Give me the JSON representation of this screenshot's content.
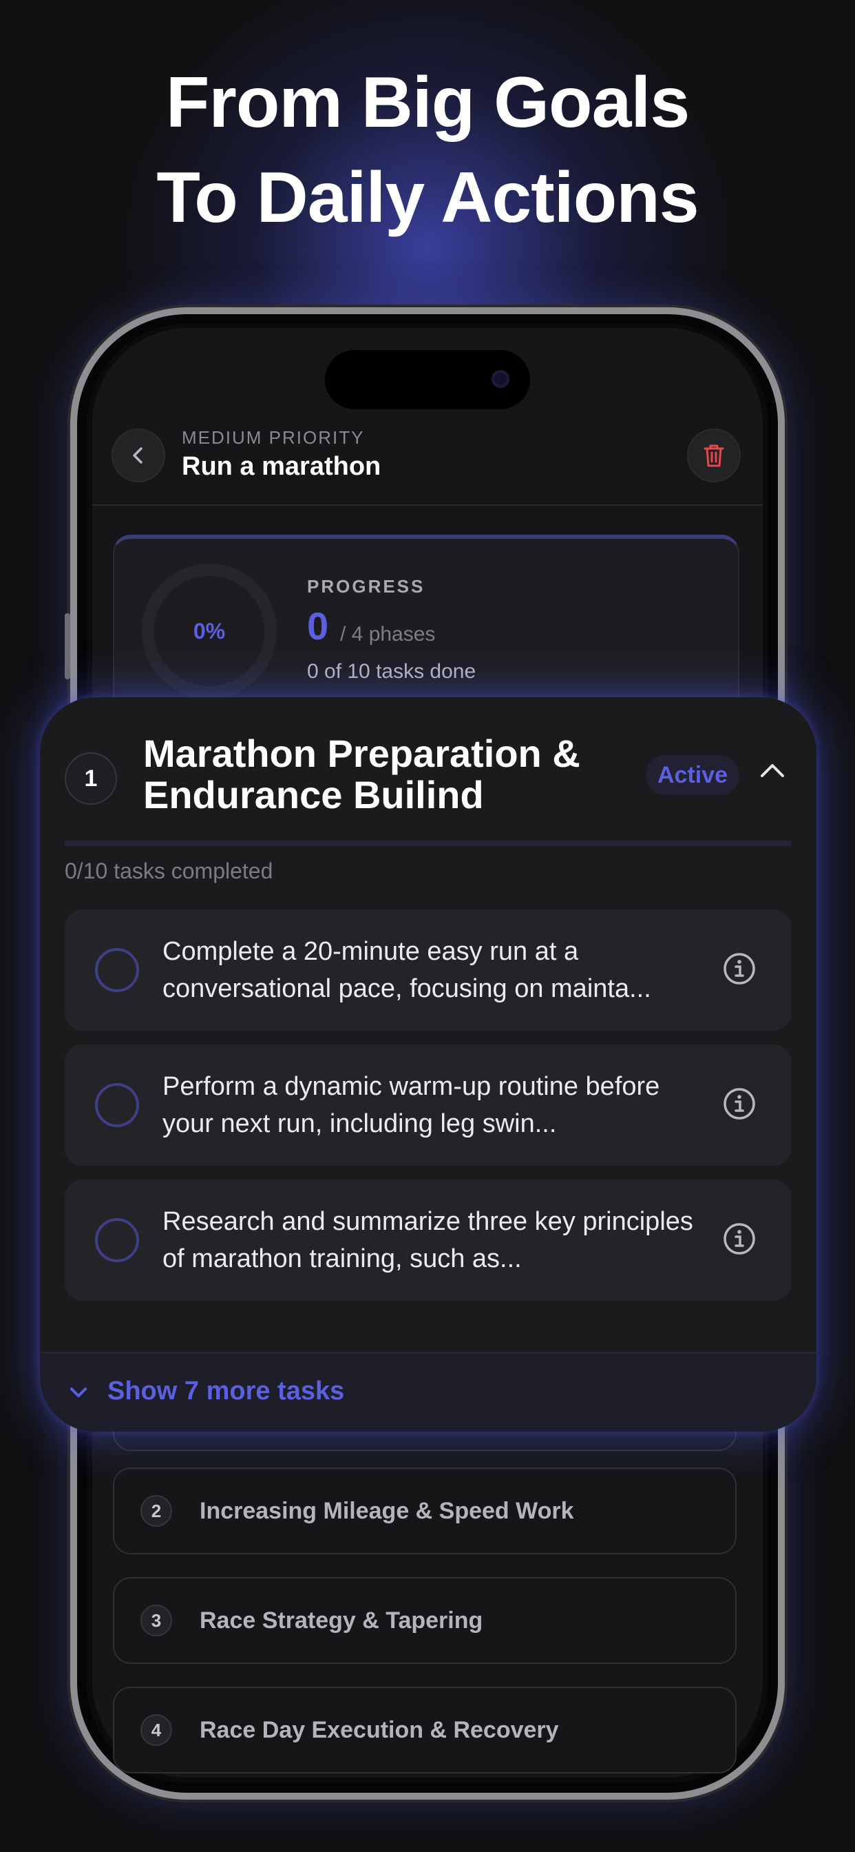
{
  "headline": {
    "line1": "From Big Goals",
    "line2": "To Daily Actions"
  },
  "goal": {
    "priority": "MEDIUM PRIORITY",
    "title": "Run a marathon"
  },
  "progress": {
    "percent_label": "0%",
    "label": "PROGRESS",
    "count": "0",
    "phases_text": "/ 4 phases",
    "tasks_text": "0 of 10 tasks done",
    "percent": 0
  },
  "active_phase": {
    "number": "1",
    "title": "Marathon Preparation & Endurance Builind",
    "badge": "Active",
    "completed_text": "0/10 tasks completed",
    "tasks": [
      {
        "text": "Complete a 20-minute easy run at a conversational pace, focusing on mainta..."
      },
      {
        "text": "Perform a dynamic warm-up routine before your next run, including leg swin..."
      },
      {
        "text": "Research and summarize three key principles of marathon training, such as..."
      }
    ],
    "show_more": "Show 7 more tasks"
  },
  "phases": [
    {
      "number": "2",
      "title": "Increasing Mileage & Speed Work"
    },
    {
      "number": "3",
      "title": "Race Strategy & Tapering"
    },
    {
      "number": "4",
      "title": "Race Day Execution & Recovery"
    }
  ],
  "colors": {
    "accent": "#5b5fe0",
    "delete": "#e5484d",
    "background": "#111113"
  },
  "icons": {
    "back": "chevron-left-icon",
    "delete": "trash-icon",
    "collapse": "chevron-up-icon",
    "info": "info-icon",
    "expand": "chevron-down-icon"
  }
}
